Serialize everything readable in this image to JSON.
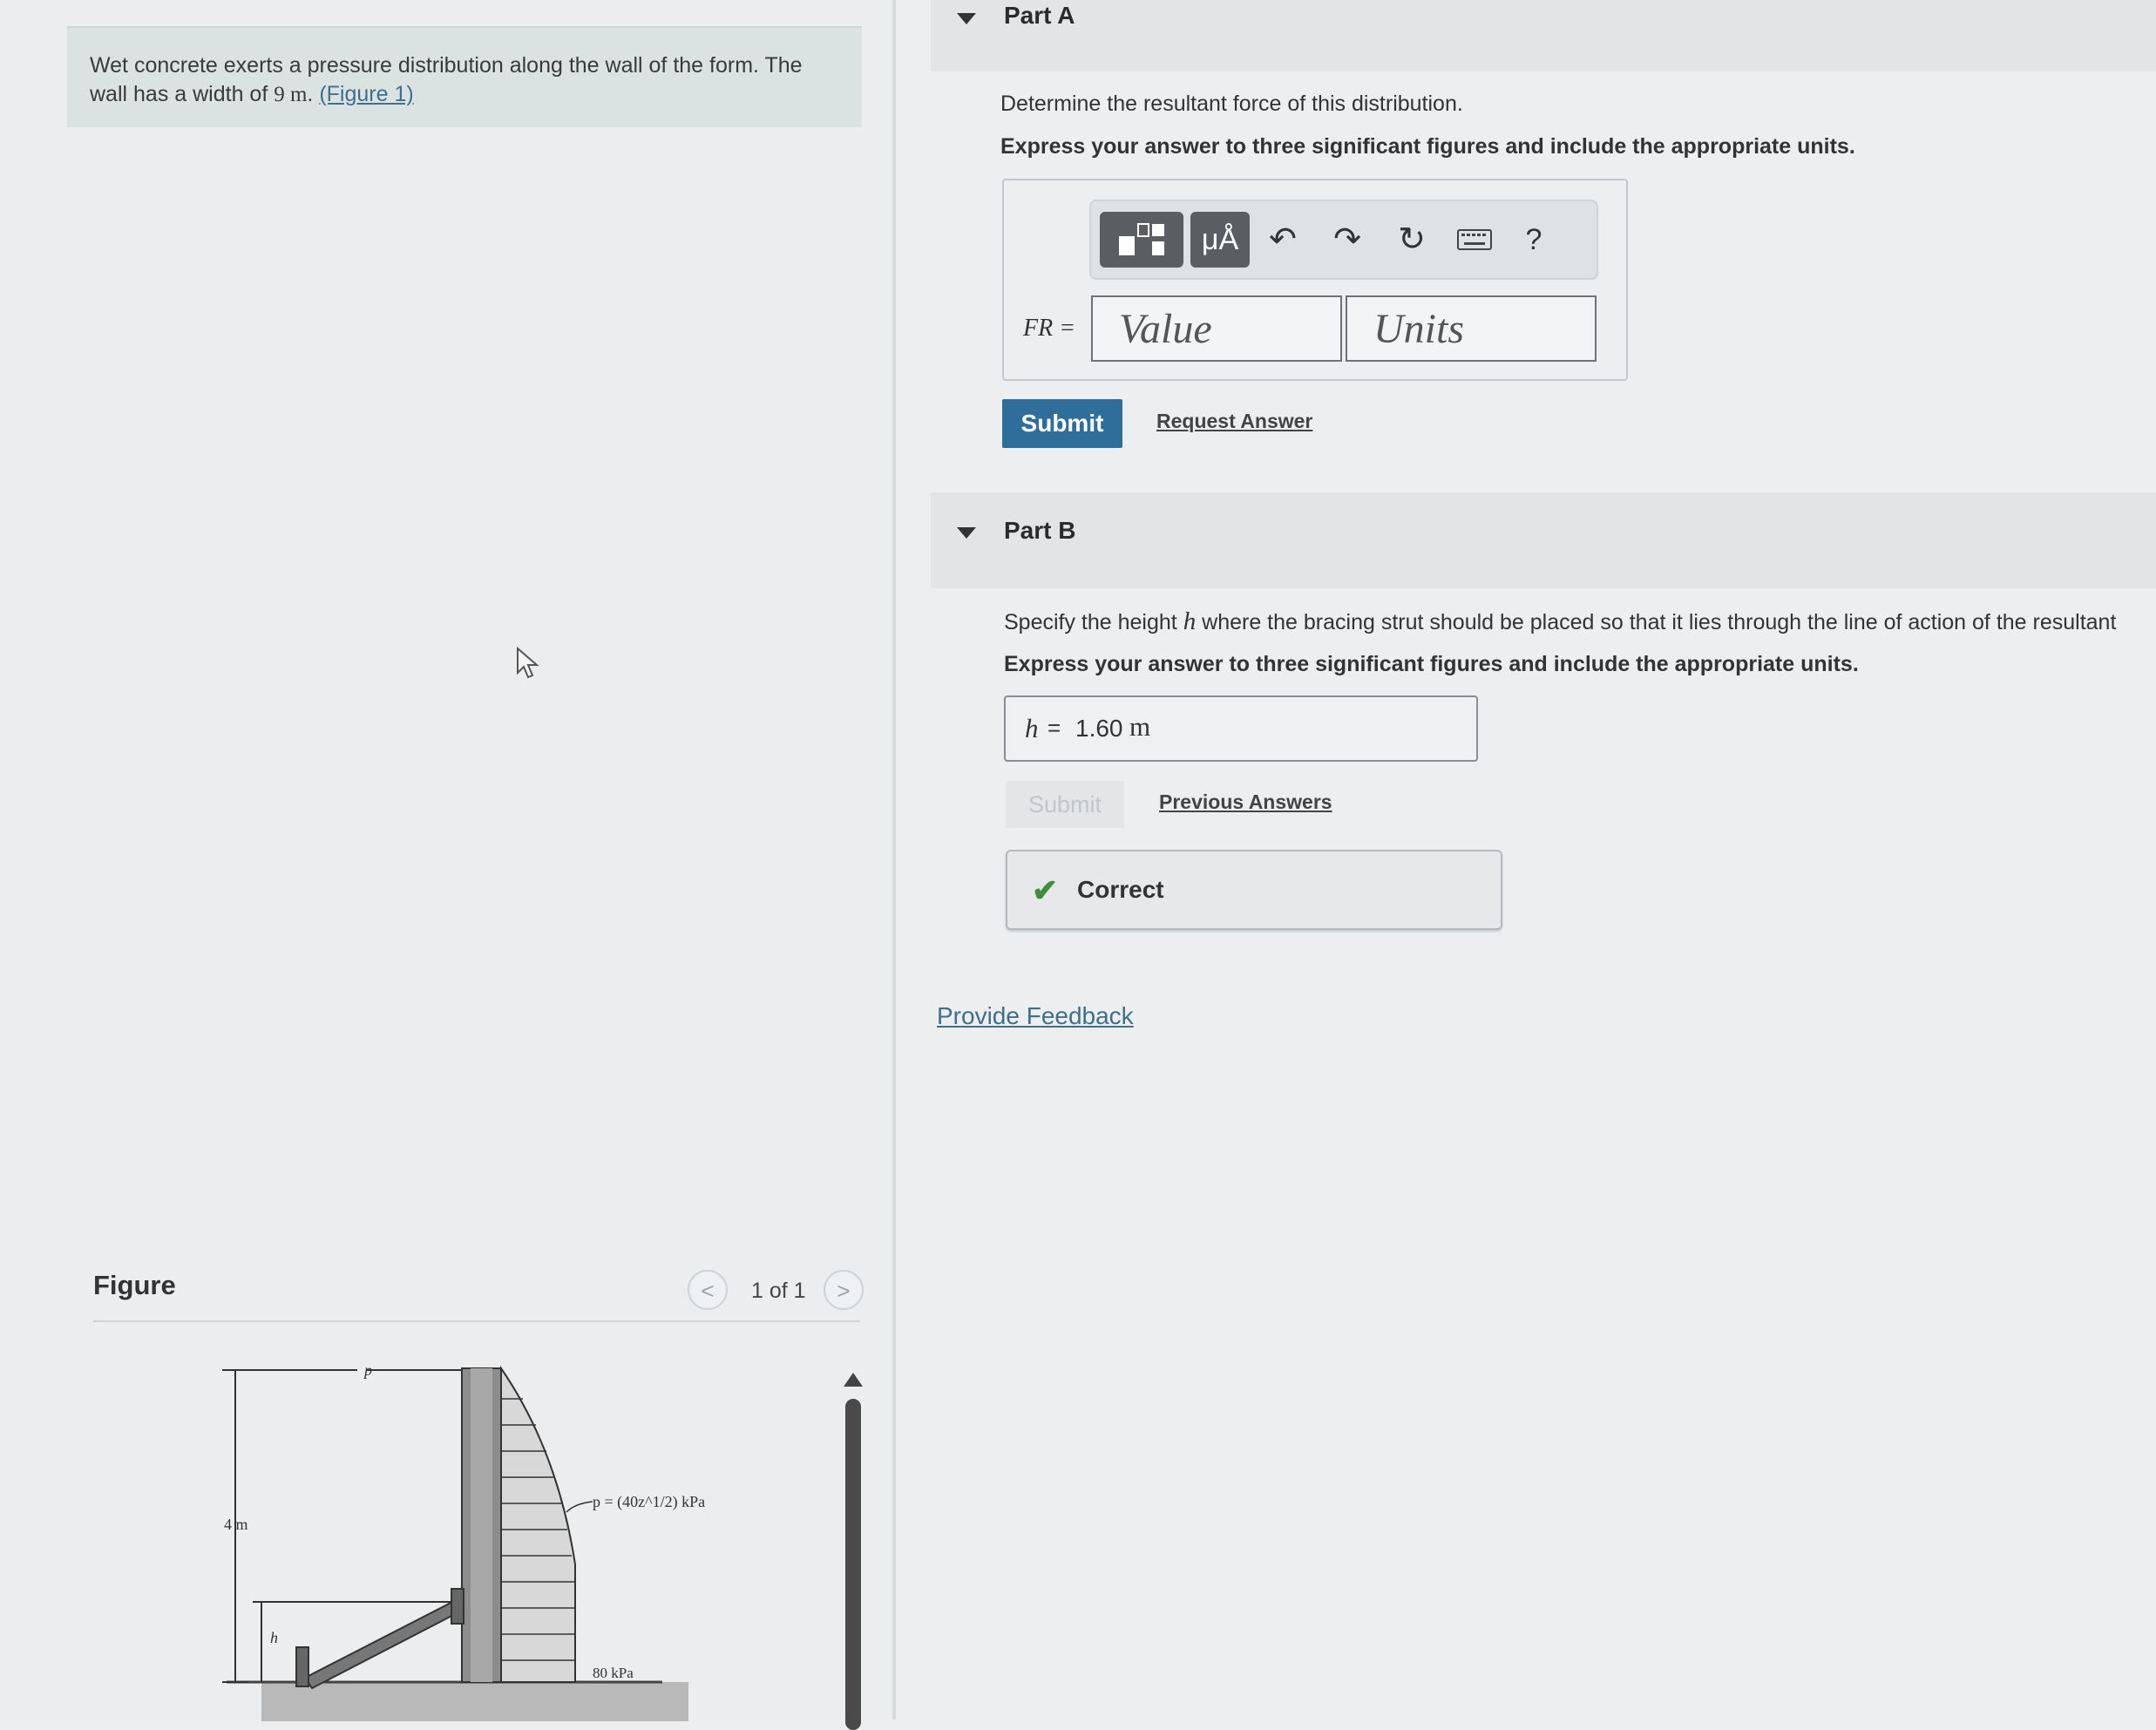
{
  "problem": {
    "text_before": "Wet concrete exerts a pressure distribution along the wall of the form. The wall has a width of ",
    "width_value": "9 m",
    "text_after": ". ",
    "figure_link": "(Figure 1)"
  },
  "figure": {
    "title": "Figure",
    "pager": "1 of 1",
    "prev_symbol": "<",
    "next_symbol": ">",
    "labels": {
      "p_top": "p",
      "height": "4 m",
      "pressure_eq": "p = (40z^1/2) kPa",
      "h": "h",
      "bottom_pressure": "80 kPa"
    }
  },
  "part_a": {
    "label": "Part A",
    "question": "Determine the resultant force of this distribution.",
    "instruction": "Express your answer to three significant figures and include the appropriate units.",
    "toolbar": {
      "units_symbol": "μÅ",
      "help": "?"
    },
    "fr_label": "FR =",
    "value_placeholder": "Value",
    "units_placeholder": "Units",
    "submit": "Submit",
    "request_answer": "Request Answer"
  },
  "part_b": {
    "label": "Part B",
    "question_before": "Specify the height ",
    "question_var": "h",
    "question_after": " where the bracing strut should be placed so that it lies through the line of action of the resultant",
    "instruction": "Express your answer to three significant figures and include the appropriate units.",
    "h_label": "h",
    "equals": "=",
    "answer_value": "1.60",
    "answer_unit": "m",
    "submit": "Submit",
    "previous_answers": "Previous Answers",
    "status": "Correct"
  },
  "provide_feedback": "Provide Feedback",
  "colors": {
    "submit_blue": "#2f6e9b",
    "correct_green": "#3e8e3a",
    "link_blue": "#3f6f8a"
  }
}
